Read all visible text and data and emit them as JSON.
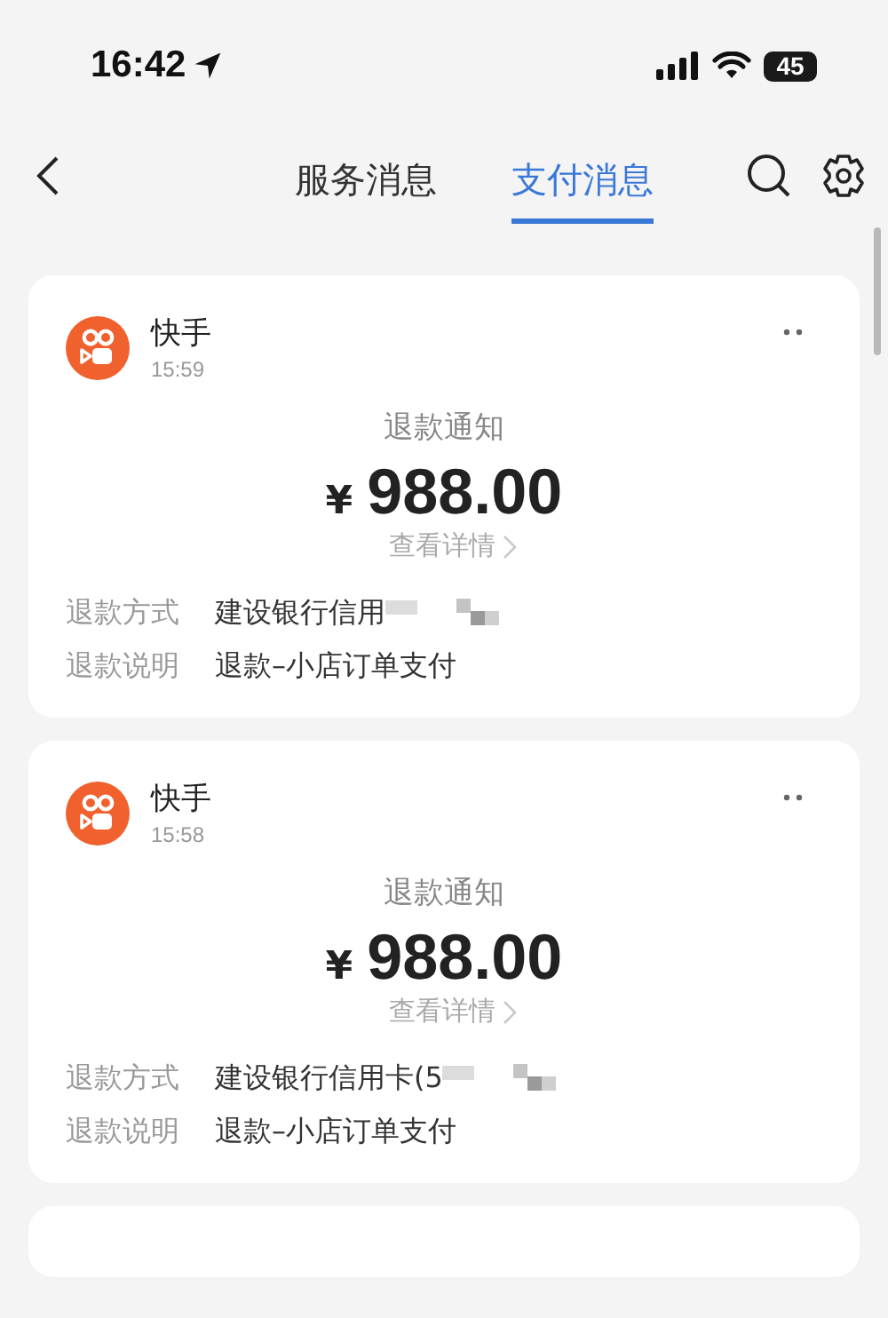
{
  "status_bar": {
    "time": "16:42",
    "battery": "45"
  },
  "nav": {
    "tabs": [
      {
        "label": "服务消息",
        "selected": false
      },
      {
        "label": "支付消息",
        "selected": true
      }
    ]
  },
  "cards": [
    {
      "sender": "快手",
      "time": "15:59",
      "title": "退款通知",
      "currency": "¥",
      "amount": "988.00",
      "link": "查看详情",
      "rows": [
        {
          "label": "退款方式",
          "value": "建设银行信用",
          "redacted": true
        },
        {
          "label": "退款说明",
          "value": "退款–小店订单支付",
          "redacted": false
        }
      ]
    },
    {
      "sender": "快手",
      "time": "15:58",
      "title": "退款通知",
      "currency": "¥",
      "amount": "988.00",
      "link": "查看详情",
      "rows": [
        {
          "label": "退款方式",
          "value": "建设银行信用卡(5",
          "redacted": true
        },
        {
          "label": "退款说明",
          "value": "退款–小店订单支付",
          "redacted": false
        }
      ]
    }
  ],
  "more_cards_below": true
}
